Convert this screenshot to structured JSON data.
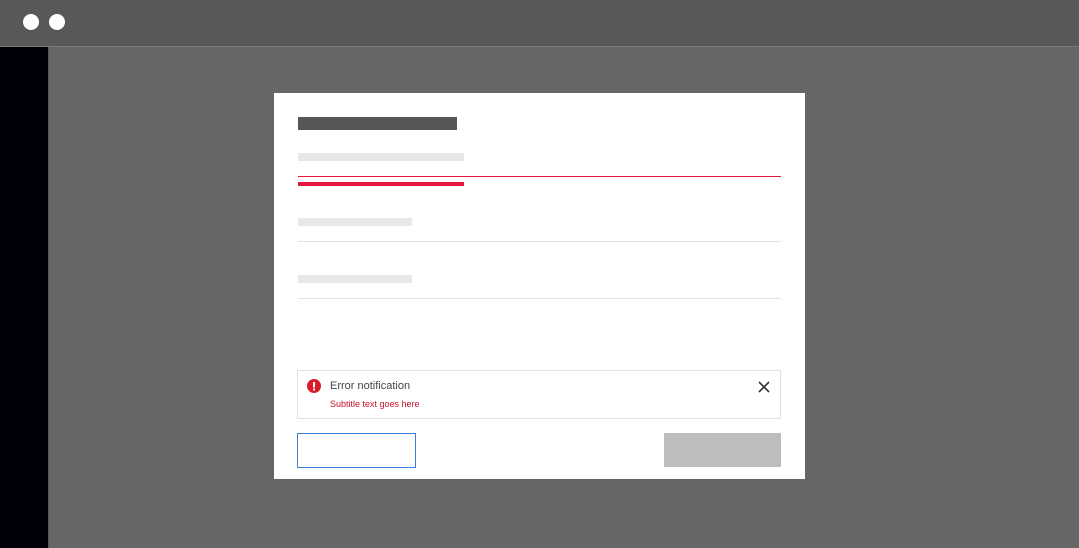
{
  "window": {
    "controls": [
      "window-dot",
      "window-dot"
    ]
  },
  "modal": {
    "notification": {
      "kind": "error",
      "icon": "error-icon",
      "title": "Error notification",
      "subtitle": "Subtitle text goes here",
      "close_icon": "close-icon"
    }
  },
  "colors": {
    "error": "#e5173f",
    "secondary_button_border": "#3b7fdc",
    "primary_button_disabled": "#bdbdbd",
    "overlay": "#666666",
    "sidebar": "#00000b"
  }
}
